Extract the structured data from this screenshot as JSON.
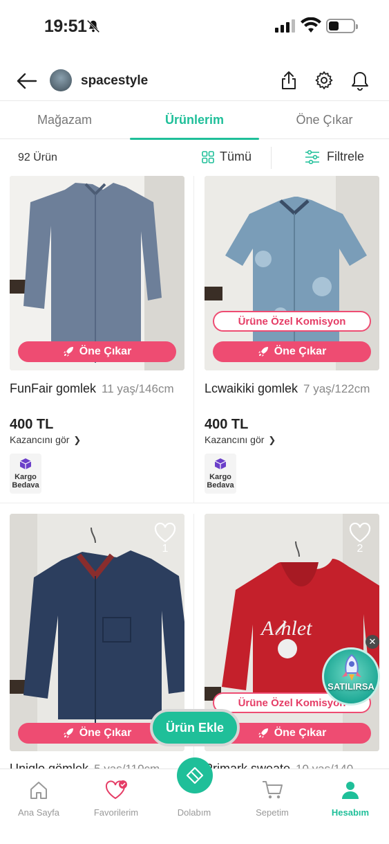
{
  "status_bar": {
    "time": "19:51"
  },
  "header": {
    "store_name": "spacestyle"
  },
  "tabs": [
    {
      "label": "Mağazam",
      "active": false
    },
    {
      "label": "Ürünlerim",
      "active": true
    },
    {
      "label": "Öne Çıkar",
      "active": false
    }
  ],
  "filter_bar": {
    "count": "92 Ürün",
    "all_label": "Tümü",
    "filter_label": "Filtrele"
  },
  "products": [
    {
      "name": "FunFair gomlek",
      "size": "11 yaş/146cm",
      "price": "400 TL",
      "earnings_link": "Kazancını gör",
      "badge_line1": "Kargo",
      "badge_line2": "Bedava",
      "boost_label": "Öne Çıkar",
      "commission_label": ""
    },
    {
      "name": "Lcwaikiki gomlek",
      "size": "7 yaş/122cm",
      "price": "400 TL",
      "earnings_link": "Kazancını gör",
      "badge_line1": "Kargo",
      "badge_line2": "Bedava",
      "boost_label": "Öne Çıkar",
      "commission_label": "Ürüne Özel Komisyon"
    },
    {
      "name": "Uniqlo gömlek",
      "size": "5 yaş/110cm",
      "likes": "1",
      "boost_label": "Öne Çıkar",
      "commission_label": ""
    },
    {
      "name": "Primark sweate",
      "size": "10 yaş/140",
      "likes": "2",
      "boost_label": "Öne Çıkar",
      "commission_label": "Ürüne Özel Komisyon"
    }
  ],
  "floating": {
    "add_product_label": "Ürün Ekle",
    "promo_label": "SATILIRSA"
  },
  "bottom_nav": [
    {
      "label": "Ana Sayfa",
      "icon": "home-icon",
      "active": false
    },
    {
      "label": "Favorilerim",
      "icon": "heart-icon",
      "active": false
    },
    {
      "label": "Dolabım",
      "icon": "hanger-icon",
      "active": false
    },
    {
      "label": "Sepetim",
      "icon": "cart-icon",
      "active": false
    },
    {
      "label": "Hesabım",
      "icon": "user-icon",
      "active": true
    }
  ],
  "colors": {
    "accent": "#1fbf99",
    "boost": "#ee4c72",
    "text": "#222222",
    "muted": "#888888"
  }
}
